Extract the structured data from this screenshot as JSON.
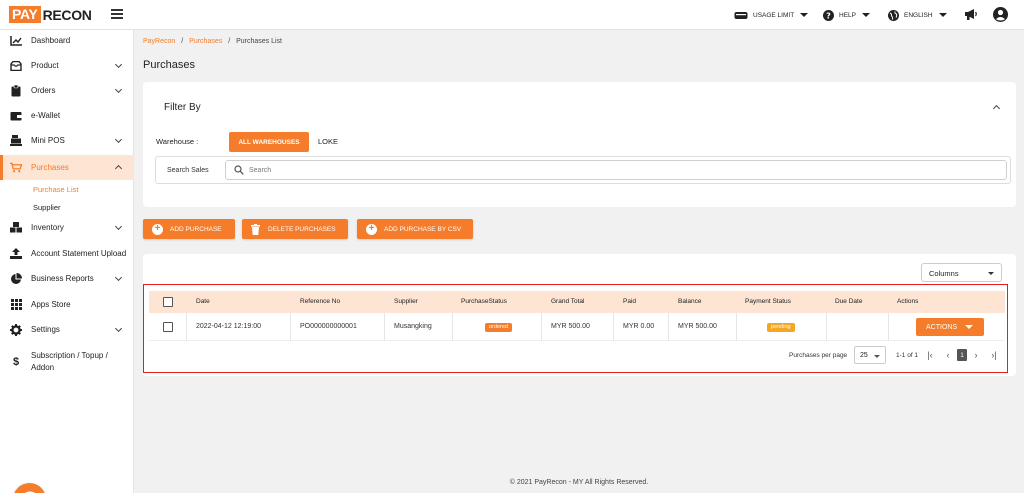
{
  "app": {
    "logo_pay": "PAY",
    "logo_recon": "RECON"
  },
  "topbar": {
    "usage_limit": "USAGE LIMIT",
    "help": "HELP",
    "language": "ENGLISH"
  },
  "sidebar": {
    "items": [
      {
        "label": "Dashboard"
      },
      {
        "label": "Product"
      },
      {
        "label": "Orders"
      },
      {
        "label": "e-Wallet"
      },
      {
        "label": "Mini POS"
      },
      {
        "label": "Purchases"
      },
      {
        "label": "Inventory"
      },
      {
        "label": "Account Statement Upload"
      },
      {
        "label": "Business Reports"
      },
      {
        "label": "Apps Store"
      },
      {
        "label": "Settings"
      },
      {
        "label": "Subscription / Topup /"
      }
    ],
    "subscription_line2": "Addon",
    "sub_items": [
      {
        "label": "Purchase List"
      },
      {
        "label": "Supplier"
      }
    ]
  },
  "breadcrumb": {
    "root": "PayRecon",
    "section": "Purchases",
    "current": "Purchases List",
    "sep": "/"
  },
  "page_title": "Purchases",
  "filter": {
    "title": "Filter By",
    "warehouse_label": "Warehouse :",
    "warehouse_selected": "ALL WAREHOUSES",
    "warehouse_other": "LOKE",
    "search_label": "Search Sales",
    "search_placeholder": "Search"
  },
  "actions": {
    "add": "ADD PURCHASE",
    "delete": "DELETE PURCHASES",
    "csv": "ADD PURCHASE BY CSV"
  },
  "table": {
    "columns_select": "Columns",
    "headers": [
      "Date",
      "Reference No",
      "Supplier",
      "PurchaseStatus",
      "Grand Total",
      "Paid",
      "Balance",
      "Payment Status",
      "Due Date",
      "Actions"
    ],
    "rows": [
      {
        "date": "2022-04-12 12:19:00",
        "reference": "PO000000000001",
        "supplier": "Musangking",
        "status": "ordered",
        "grand_total": "MYR 500.00",
        "paid": "MYR 0.00",
        "balance": "MYR 500.00",
        "payment_status": "pending",
        "due_date": "",
        "action_label": "ACTIONS"
      }
    ],
    "per_page_label": "Purchases per page",
    "per_page_value": "25",
    "range": "1-1 of 1",
    "current_page": "1"
  },
  "footer": "© 2021 PayRecon - MY All Rights Reserved.",
  "colors": {
    "accent": "#f47c2a",
    "header_bg": "#fde4d3",
    "pending": "#f5a623",
    "frame": "#e02020"
  }
}
